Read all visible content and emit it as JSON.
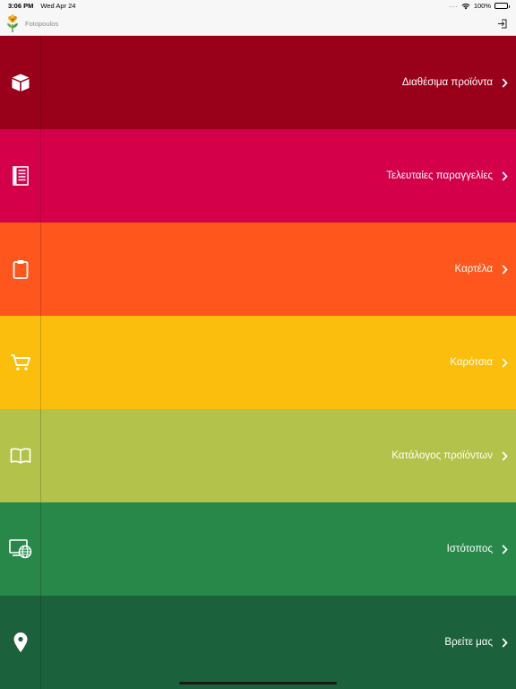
{
  "status_bar": {
    "time": "3:06 PM",
    "date": "Wed Apr 24",
    "signal": "....",
    "battery": "100%"
  },
  "header": {
    "title": "Fotopoulos"
  },
  "menu": {
    "items": [
      {
        "label": "Διαθέσιμα προϊόντα",
        "icon": "box-icon",
        "color": "#990019"
      },
      {
        "label": "Τελευταίες παραγγελίες",
        "icon": "receipt-list-icon",
        "color": "#d5004a"
      },
      {
        "label": "Καρτέλα",
        "icon": "clipboard-icon",
        "color": "#fe561c"
      },
      {
        "label": "Καρότσια",
        "icon": "cart-icon",
        "color": "#fbbe0c"
      },
      {
        "label": "Κατάλογος προϊόντων",
        "icon": "open-book-icon",
        "color": "#b3c24a"
      },
      {
        "label": "Ιστότοπος",
        "icon": "globe-monitor-icon",
        "color": "#27884a"
      },
      {
        "label": "Βρείτε μας",
        "icon": "map-pin-icon",
        "color": "#1b623c"
      }
    ]
  }
}
